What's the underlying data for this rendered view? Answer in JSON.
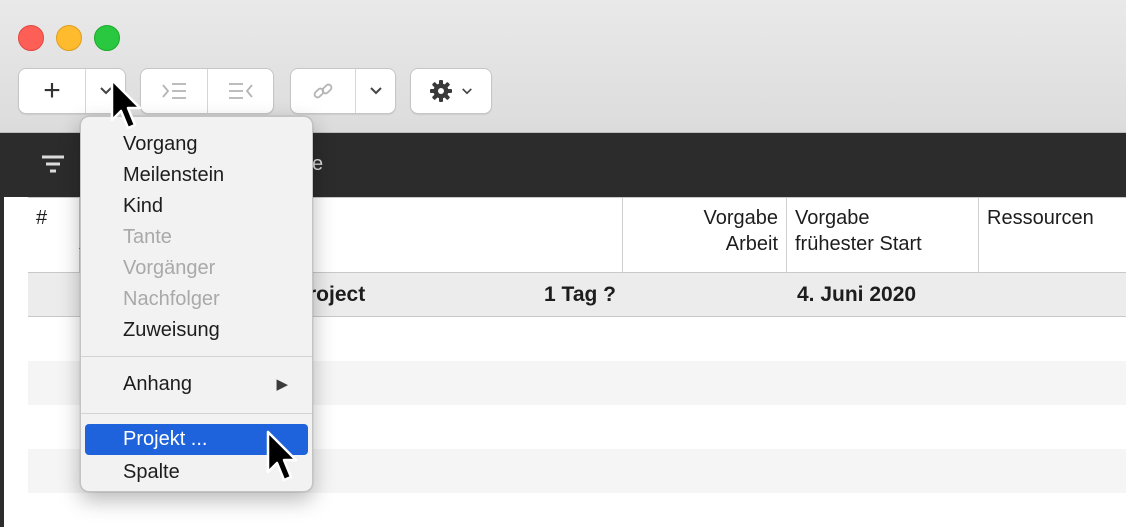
{
  "toolbar": {
    "add_label": "+",
    "chevron_label": "⌄"
  },
  "darkbar": {
    "label_fragment": "e"
  },
  "table": {
    "headers": {
      "number": "#",
      "work_line1": "Vorgabe",
      "work_line2": "Arbeit",
      "start_line1": "Vorgabe",
      "start_line2": "frühester Start",
      "resources": "Ressourcen"
    },
    "summary_row": {
      "name_fragment": "roject",
      "work": "1 Tag ?",
      "start": "4. Juni 2020"
    }
  },
  "menu": {
    "items": [
      {
        "label": "Vorgang",
        "enabled": true
      },
      {
        "label": "Meilenstein",
        "enabled": true
      },
      {
        "label": "Kind",
        "enabled": true
      },
      {
        "label": "Tante",
        "enabled": false
      },
      {
        "label": "Vorgänger",
        "enabled": false
      },
      {
        "label": "Nachfolger",
        "enabled": false
      },
      {
        "label": "Zuweisung",
        "enabled": true
      },
      {
        "label": "Anhang",
        "enabled": true,
        "submenu": true
      },
      {
        "label": "Projekt ...",
        "enabled": true,
        "highlighted": true
      },
      {
        "label": "Spalte",
        "enabled": true
      }
    ]
  },
  "colors": {
    "accent": "#1f63dc",
    "close": "#fd5f57",
    "minimize": "#febb2e",
    "maximize": "#29c840",
    "dark_bar": "#2c2c2c"
  }
}
